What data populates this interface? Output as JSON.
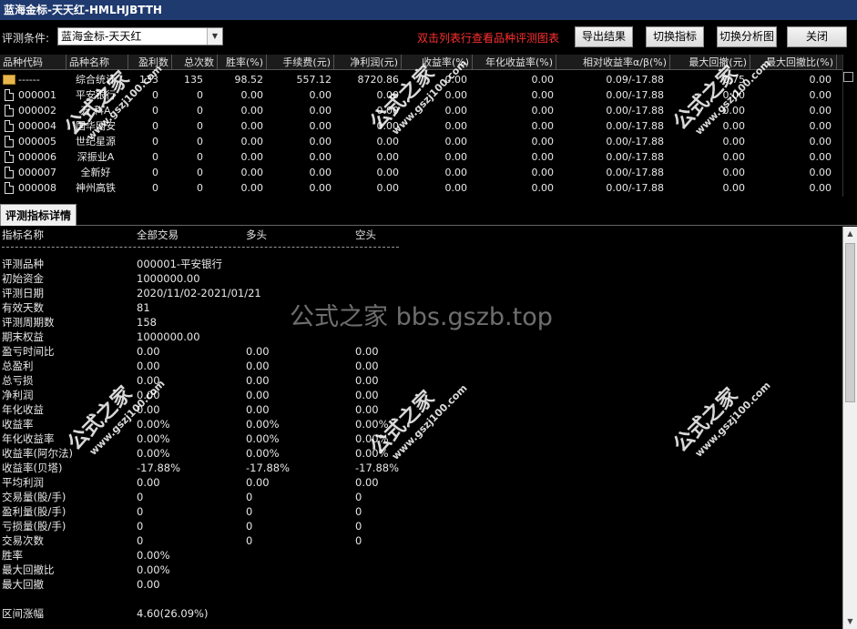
{
  "window": {
    "title": "蓝海金标-天天红-HMLHJBTTH"
  },
  "toolbar": {
    "condition_label": "评测条件:",
    "condition_value": "蓝海金标-天天红",
    "hint": "双击列表行查看品种评测图表",
    "export_label": "导出结果",
    "switch_indicator_label": "切换指标",
    "switch_chart_label": "切换分析图",
    "close_label": "关闭"
  },
  "grid": {
    "columns": [
      "品种代码",
      "品种名称",
      "盈利数",
      "总次数",
      "胜率(%)",
      "手续费(元)",
      "净利润(元)",
      "收益率(%)",
      "年化收益率(%)",
      "相对收益率α/β(%)",
      "最大回撤(元)",
      "最大回撤比(%)"
    ],
    "rows": [
      {
        "icon": "folder-icon",
        "code": "------",
        "name": "综合统计",
        "win": "133",
        "total": "135",
        "rate": "98.52",
        "fee": "557.12",
        "profit": "8720.86",
        "ret": "0.00",
        "annual": "0.00",
        "relative": "0.09/-17.88",
        "maxdd": "0.75",
        "maxddr": "0.00"
      },
      {
        "icon": "doc-icon",
        "code": "000001",
        "name": "平安银行",
        "win": "0",
        "total": "0",
        "rate": "0.00",
        "fee": "0.00",
        "profit": "0.00",
        "ret": "0.00",
        "annual": "0.00",
        "relative": "0.00/-17.88",
        "maxdd": "0.00",
        "maxddr": "0.00"
      },
      {
        "icon": "doc-icon",
        "code": "000002",
        "name": "万 科A",
        "win": "0",
        "total": "0",
        "rate": "0.00",
        "fee": "0.00",
        "profit": "0.00",
        "ret": "0.00",
        "annual": "0.00",
        "relative": "0.00/-17.88",
        "maxdd": "0.00",
        "maxddr": "0.00"
      },
      {
        "icon": "doc-icon",
        "code": "000004",
        "name": "国华网安",
        "win": "0",
        "total": "0",
        "rate": "0.00",
        "fee": "0.00",
        "profit": "0.00",
        "ret": "0.00",
        "annual": "0.00",
        "relative": "0.00/-17.88",
        "maxdd": "0.00",
        "maxddr": "0.00"
      },
      {
        "icon": "doc-icon",
        "code": "000005",
        "name": "世纪星源",
        "win": "0",
        "total": "0",
        "rate": "0.00",
        "fee": "0.00",
        "profit": "0.00",
        "ret": "0.00",
        "annual": "0.00",
        "relative": "0.00/-17.88",
        "maxdd": "0.00",
        "maxddr": "0.00"
      },
      {
        "icon": "doc-icon",
        "code": "000006",
        "name": "深振业A",
        "win": "0",
        "total": "0",
        "rate": "0.00",
        "fee": "0.00",
        "profit": "0.00",
        "ret": "0.00",
        "annual": "0.00",
        "relative": "0.00/-17.88",
        "maxdd": "0.00",
        "maxddr": "0.00"
      },
      {
        "icon": "doc-icon",
        "code": "000007",
        "name": "全新好",
        "win": "0",
        "total": "0",
        "rate": "0.00",
        "fee": "0.00",
        "profit": "0.00",
        "ret": "0.00",
        "annual": "0.00",
        "relative": "0.00/-17.88",
        "maxdd": "0.00",
        "maxddr": "0.00"
      },
      {
        "icon": "doc-icon",
        "code": "000008",
        "name": "神州高铁",
        "win": "0",
        "total": "0",
        "rate": "0.00",
        "fee": "0.00",
        "profit": "0.00",
        "ret": "0.00",
        "annual": "0.00",
        "relative": "0.00/-17.88",
        "maxdd": "0.00",
        "maxddr": "0.00"
      }
    ]
  },
  "tab": {
    "label": "评测指标详情"
  },
  "detail": {
    "headers": [
      "指标名称",
      "全部交易",
      "多头",
      "空头"
    ],
    "rows": [
      [
        "评测品种",
        "000001-平安银行",
        "",
        ""
      ],
      [
        "初始资金",
        "1000000.00",
        "",
        ""
      ],
      [
        "评测日期",
        "2020/11/02-2021/01/21",
        "",
        ""
      ],
      [
        "有效天数",
        "81",
        "",
        ""
      ],
      [
        "评测周期数",
        "158",
        "",
        ""
      ],
      [
        "期末权益",
        "1000000.00",
        "",
        ""
      ],
      [
        "盈亏时间比",
        "0.00",
        "0.00",
        "0.00"
      ],
      [
        "总盈利",
        "0.00",
        "0.00",
        "0.00"
      ],
      [
        "总亏损",
        "0.00",
        "0.00",
        "0.00"
      ],
      [
        "净利润",
        "0.00",
        "0.00",
        "0.00"
      ],
      [
        "年化收益",
        "0.00",
        "0.00",
        "0.00"
      ],
      [
        "收益率",
        "0.00%",
        "0.00%",
        "0.00%"
      ],
      [
        "年化收益率",
        "0.00%",
        "0.00%",
        "0.00%"
      ],
      [
        "收益率(阿尔法)",
        "0.00%",
        "0.00%",
        "0.00%"
      ],
      [
        "收益率(贝塔)",
        "-17.88%",
        "-17.88%",
        "-17.88%"
      ],
      [
        "平均利润",
        "0.00",
        "0.00",
        "0.00"
      ],
      [
        "交易量(股/手)",
        "0",
        "0",
        "0"
      ],
      [
        "盈利量(股/手)",
        "0",
        "0",
        "0"
      ],
      [
        "亏损量(股/手)",
        "0",
        "0",
        "0"
      ],
      [
        "交易次数",
        "0",
        "0",
        "0"
      ],
      [
        "胜率",
        "0.00%",
        "",
        ""
      ],
      [
        "最大回撤比",
        "0.00%",
        "",
        ""
      ],
      [
        "最大回撤",
        "0.00",
        "",
        ""
      ],
      [
        "",
        "",
        "",
        ""
      ],
      [
        "区间涨幅",
        "4.60(26.09%)",
        "",
        ""
      ]
    ]
  },
  "watermarks": {
    "center": "公式之家 bbs.gszb.top",
    "brand": "公式之家",
    "url": "www.gszj100.com"
  }
}
